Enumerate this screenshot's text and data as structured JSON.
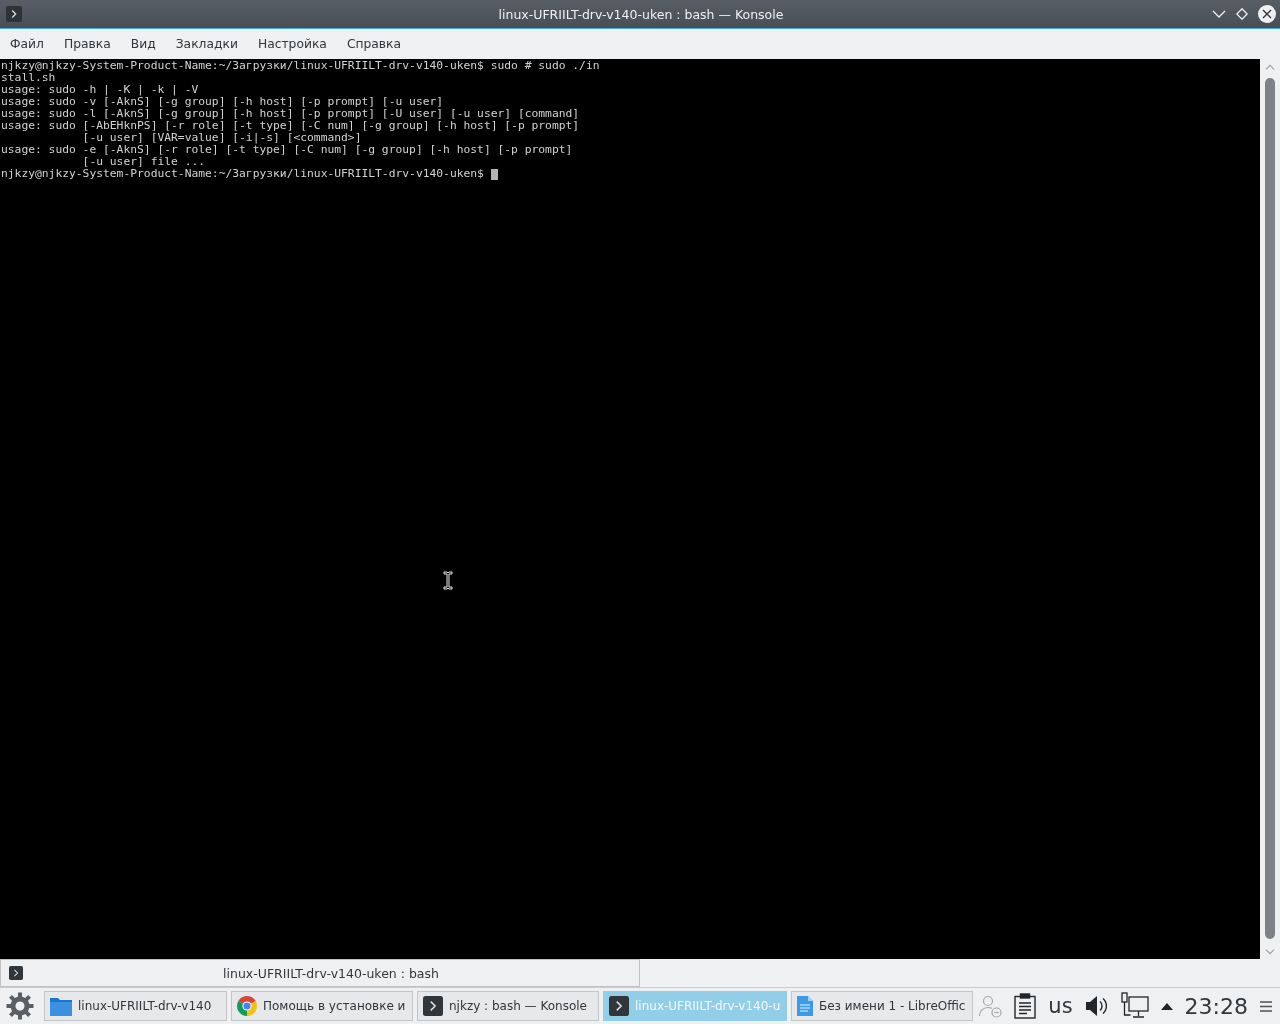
{
  "window": {
    "title": "linux-UFRIILT-drv-v140-uken : bash — Konsole"
  },
  "menu": [
    {
      "label": "Файл"
    },
    {
      "label": "Правка"
    },
    {
      "label": "Вид"
    },
    {
      "label": "Закладки"
    },
    {
      "label": "Настройка"
    },
    {
      "label": "Справка"
    }
  ],
  "terminal": {
    "lines": [
      "njkzy@njkzy-System-Product-Name:~/Загрузки/linux-UFRIILT-drv-v140-uken$ sudo # sudo ./in",
      "stall.sh",
      "usage: sudo -h | -K | -k | -V",
      "usage: sudo -v [-AknS] [-g group] [-h host] [-p prompt] [-u user]",
      "usage: sudo -l [-AknS] [-g group] [-h host] [-p prompt] [-U user] [-u user] [command]",
      "usage: sudo [-AbEHknPS] [-r role] [-t type] [-C num] [-g group] [-h host] [-p prompt]",
      "            [-u user] [VAR=value] [-i|-s] [<command>]",
      "usage: sudo -e [-AknS] [-r role] [-t type] [-C num] [-g group] [-h host] [-p prompt]",
      "            [-u user] file ..."
    ],
    "prompt": "njkzy@njkzy-System-Product-Name:~/Загрузки/linux-UFRIILT-drv-v140-uken$"
  },
  "tabs": [
    {
      "label": "linux-UFRIILT-drv-v140-uken : bash"
    }
  ],
  "taskbar": {
    "tasks": [
      {
        "kind": "files",
        "label": "linux-UFRIILT-drv-v140",
        "selected": false
      },
      {
        "kind": "browser",
        "label": "Помощь в установке и",
        "selected": false
      },
      {
        "kind": "terminal",
        "label": "njkzy : bash — Konsole",
        "selected": false
      },
      {
        "kind": "terminal",
        "label": "linux-UFRIILT-drv-v140-u",
        "selected": true
      },
      {
        "kind": "writer",
        "label": "Без имени 1 - LibreOffic",
        "selected": false
      }
    ],
    "keyboard_layout": "us",
    "clock": "23:28"
  }
}
